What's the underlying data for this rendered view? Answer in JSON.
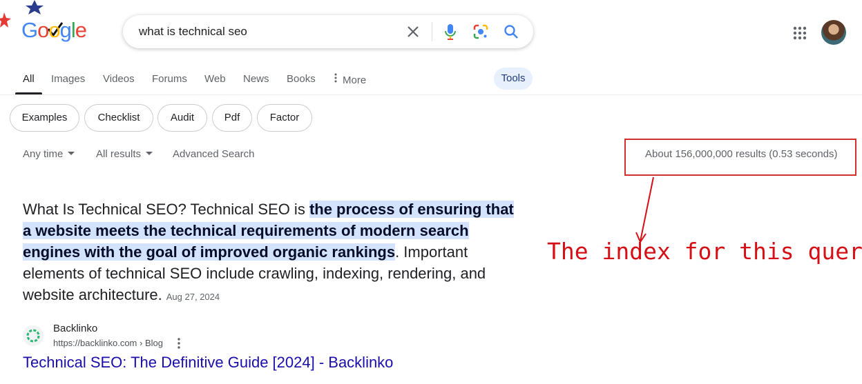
{
  "logo": {
    "letters": [
      "G",
      "o",
      "o",
      "g",
      "l",
      "e"
    ]
  },
  "search": {
    "query": "what is technical seo"
  },
  "icons": {
    "clear": "close-icon",
    "voice": "microphone-icon",
    "lens": "camera-lens-icon",
    "search": "search-icon",
    "apps": "apps-grid-icon"
  },
  "tabs": [
    {
      "label": "All",
      "active": true
    },
    {
      "label": "Images"
    },
    {
      "label": "Videos"
    },
    {
      "label": "Forums"
    },
    {
      "label": "Web"
    },
    {
      "label": "News"
    },
    {
      "label": "Books"
    },
    {
      "label": "More"
    }
  ],
  "tools_label": "Tools",
  "chips": [
    "Examples",
    "Checklist",
    "Audit",
    "Pdf",
    "Factor"
  ],
  "tools_row": {
    "time": "Any time",
    "results": "All results",
    "advanced": "Advanced Search",
    "stats": "About 156,000,000 results (0.53 seconds)"
  },
  "annotation": {
    "text": "The index for this query",
    "color": "#d50f15"
  },
  "snippet": {
    "prefix": "What Is Technical SEO? Technical SEO is ",
    "highlight": "the process of ensuring that a website meets the technical requirements of modern search engines with the goal of improved organic rankings",
    "suffix": ". Important elements of technical SEO include crawling, indexing, rendering, and website architecture.",
    "date": "Aug 27, 2024"
  },
  "result": {
    "site_name": "Backlinko",
    "url": "https://backlinko.com › Blog",
    "title": "Technical SEO: The Definitive Guide [2024] - Backlinko"
  },
  "colors": {
    "link": "#1a0dab",
    "highlight": "#d3e3fd",
    "tools_bg": "#e8f0fe",
    "annotation_red": "#d50f15"
  }
}
